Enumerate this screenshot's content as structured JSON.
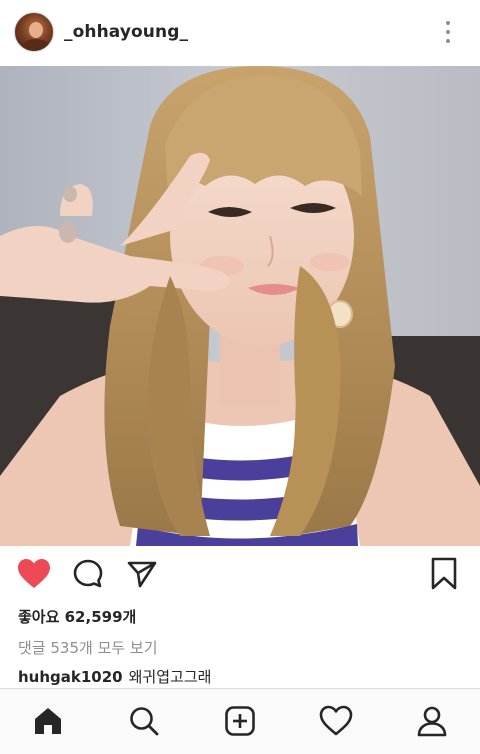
{
  "post": {
    "username": "_ohhayoung_",
    "likes_text": "좋아요 62,599개",
    "view_comments_text": "댓글 535개 모두 보기",
    "comment": {
      "user": "huhgak1020",
      "text": "왜귀엽고그래"
    },
    "liked": true
  },
  "icons": {
    "more": "more-vertical-icon",
    "like": "heart-filled-icon",
    "comment": "comment-bubble-icon",
    "share": "paper-plane-icon",
    "save": "bookmark-icon"
  },
  "tabs": [
    {
      "name": "home",
      "icon": "home-icon"
    },
    {
      "name": "search",
      "icon": "search-icon"
    },
    {
      "name": "new-post",
      "icon": "plus-square-icon"
    },
    {
      "name": "activity",
      "icon": "heart-outline-icon"
    },
    {
      "name": "profile",
      "icon": "person-icon"
    }
  ],
  "colors": {
    "like_red": "#ed4956",
    "text": "#262626",
    "muted": "#8e8e8e"
  }
}
